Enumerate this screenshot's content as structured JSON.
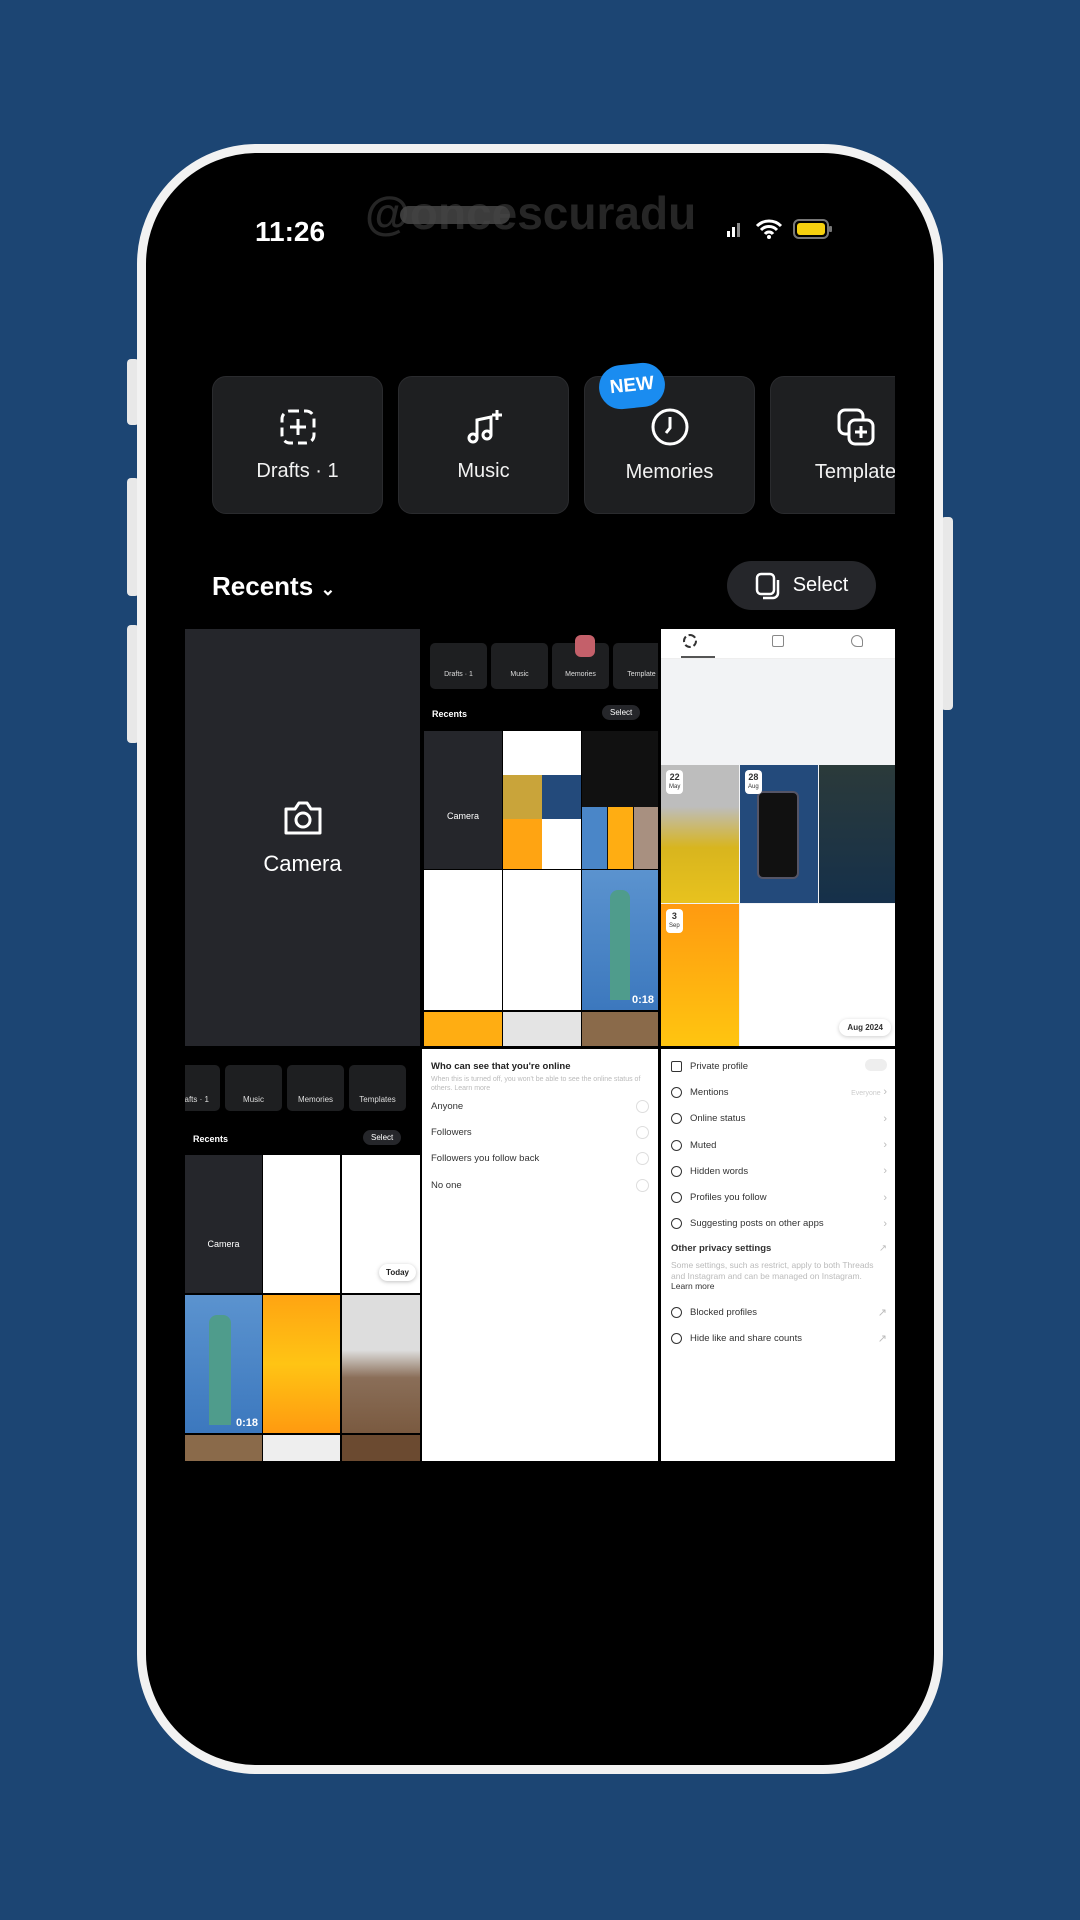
{
  "status_bar": {
    "time": "11:26",
    "battery_color": "#f5d00f"
  },
  "watermark": "@oncescuradu",
  "shortcuts": [
    {
      "label": "Drafts · 1",
      "icon": "dashed-plus-icon"
    },
    {
      "label": "Music",
      "icon": "music-plus-icon"
    },
    {
      "label": "Memories",
      "icon": "clock-icon",
      "badge": "NEW"
    },
    {
      "label": "Template",
      "icon": "copy-plus-icon"
    }
  ],
  "gallery": {
    "album": "Recents",
    "select_label": "Select",
    "camera_label": "Camera"
  },
  "thumb_recents": {
    "drafts": "Drafts · 1",
    "music": "Music",
    "memories": "Memories",
    "template": "Template",
    "templates": "Templates",
    "recents": "Recents",
    "select": "Select",
    "camera": "Camera",
    "duration": "0:18",
    "today": "Today"
  },
  "thumb_calendar": {
    "dates": [
      {
        "day": "22",
        "month": "May"
      },
      {
        "day": "28",
        "month": "Aug"
      },
      {
        "day": "3",
        "month": "Sep"
      }
    ],
    "month_chip": "Aug 2024"
  },
  "online_status": {
    "title": "Who can see that you're online",
    "desc": "When this is turned off, you won't be able to see the online status of others. Learn more",
    "options": [
      "Anyone",
      "Followers",
      "Followers you follow back",
      "No one"
    ]
  },
  "privacy": {
    "items": [
      {
        "label": "Private profile",
        "type": "toggle"
      },
      {
        "label": "Mentions",
        "value": "Everyone"
      },
      {
        "label": "Online status"
      },
      {
        "label": "Muted"
      },
      {
        "label": "Hidden words"
      },
      {
        "label": "Profiles you follow"
      },
      {
        "label": "Suggesting posts on other apps"
      }
    ],
    "other_title": "Other privacy settings",
    "other_desc": "Some settings, such as restrict, apply to both Threads and Instagram and can be managed on Instagram.",
    "learn_more": "Learn more",
    "links": [
      "Blocked profiles",
      "Hide like and share counts"
    ]
  }
}
